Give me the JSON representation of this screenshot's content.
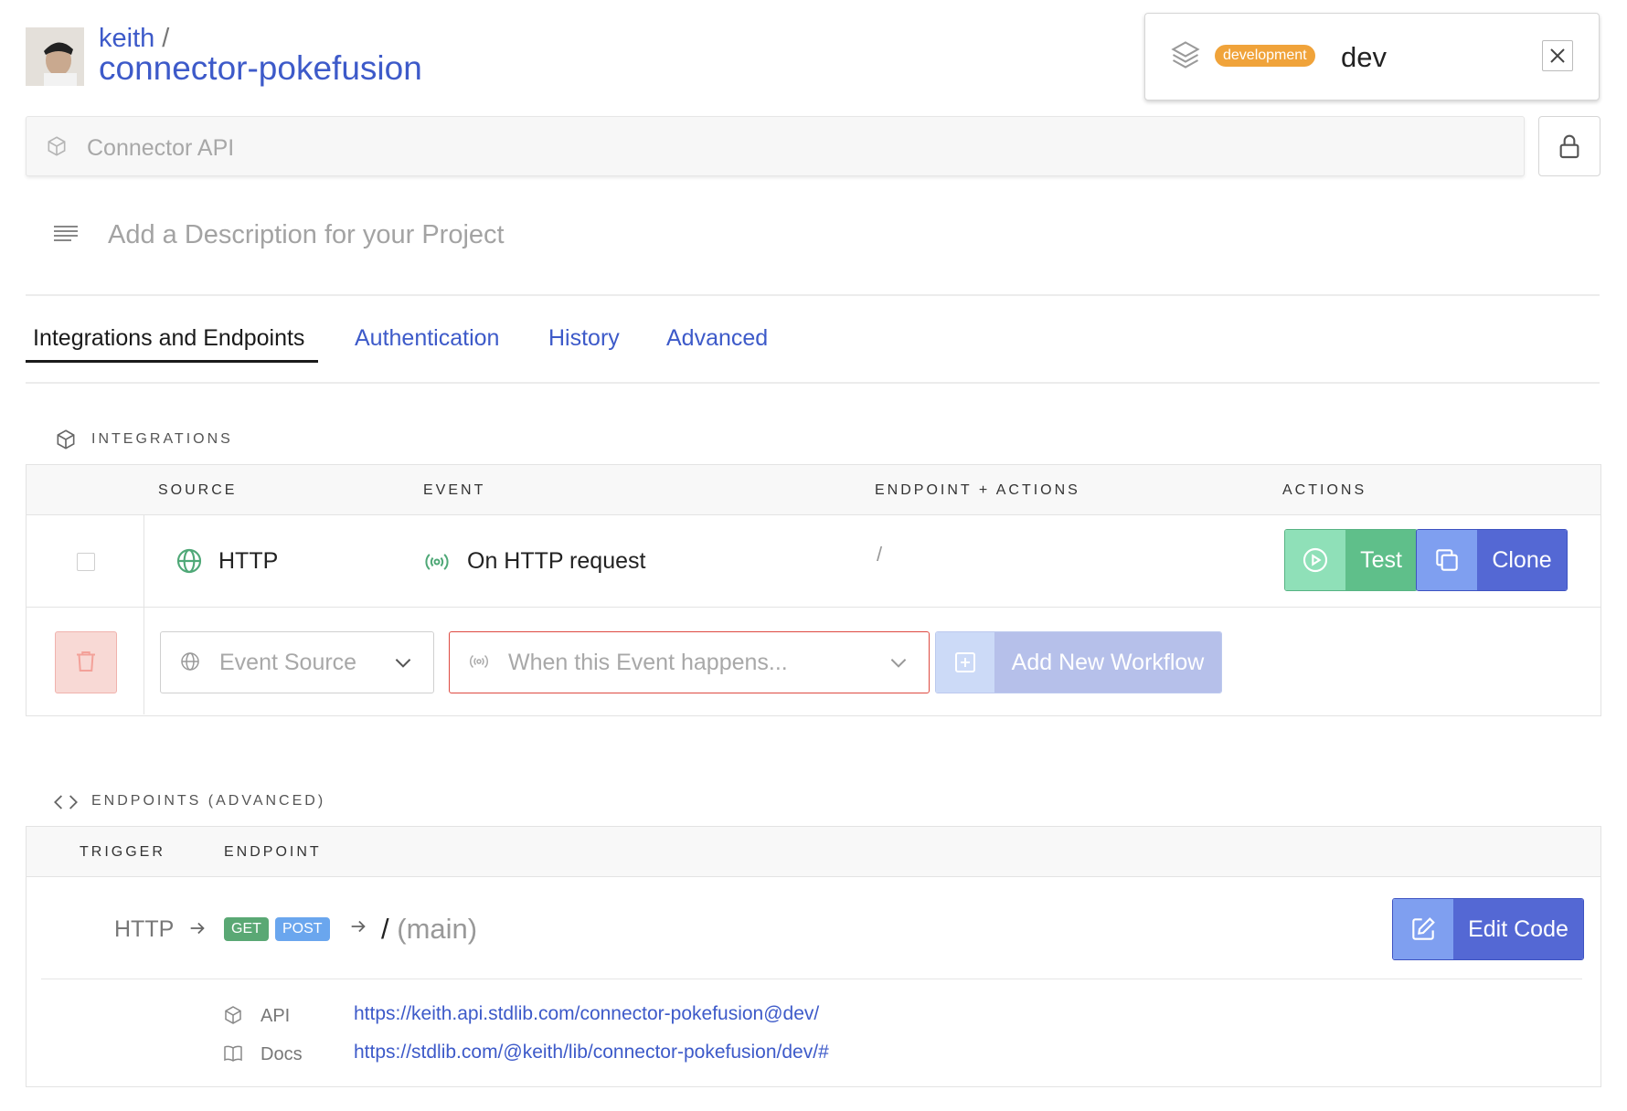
{
  "header": {
    "username": "keith",
    "separator": "/",
    "project_name": "connector-pokefusion"
  },
  "environment": {
    "badge": "development",
    "name": "dev"
  },
  "api_field": {
    "label": "Connector API"
  },
  "description": {
    "placeholder": "Add a Description for your Project"
  },
  "tabs": [
    {
      "label": "Integrations and Endpoints",
      "active": true
    },
    {
      "label": "Authentication",
      "active": false
    },
    {
      "label": "History",
      "active": false
    },
    {
      "label": "Advanced",
      "active": false
    }
  ],
  "integrations": {
    "title": "INTEGRATIONS",
    "columns": [
      "SOURCE",
      "EVENT",
      "ENDPOINT + ACTIONS",
      "ACTIONS"
    ],
    "rows": [
      {
        "source": "HTTP",
        "event": "On HTTP request",
        "endpoint": "/",
        "test_label": "Test",
        "clone_label": "Clone"
      }
    ],
    "new_row": {
      "event_source_placeholder": "Event Source",
      "event_placeholder": "When this Event happens...",
      "add_label": "Add New Workflow"
    }
  },
  "endpoints": {
    "title": "ENDPOINTS (ADVANCED)",
    "columns": [
      "TRIGGER",
      "ENDPOINT"
    ],
    "rows": [
      {
        "trigger": "HTTP",
        "methods": [
          "GET",
          "POST"
        ],
        "path": "/",
        "path_suffix": "(main)",
        "edit_label": "Edit Code",
        "links": [
          {
            "label": "API",
            "url": "https://keith.api.stdlib.com/connector-pokefusion@dev/"
          },
          {
            "label": "Docs",
            "url": "https://stdlib.com/@keith/lib/connector-pokefusion/dev/#"
          }
        ]
      }
    ]
  },
  "colors": {
    "accent": "#3d5ac9",
    "badge_orange": "#f0a33a",
    "test_green": "#5fbf8a",
    "clone_blue": "#5468d4",
    "danger_red": "#e0564e",
    "get_green": "#5aa874",
    "post_blue": "#6aa6ee"
  },
  "icons": [
    "layers-icon",
    "close-icon",
    "cube-icon",
    "lock-icon",
    "paragraph-icon",
    "globe-icon",
    "broadcast-icon",
    "play-icon",
    "copy-icon",
    "trash-icon",
    "chevron-down-icon",
    "plus-square-icon",
    "code-icon",
    "arrow-right-icon",
    "edit-icon",
    "book-icon"
  ]
}
